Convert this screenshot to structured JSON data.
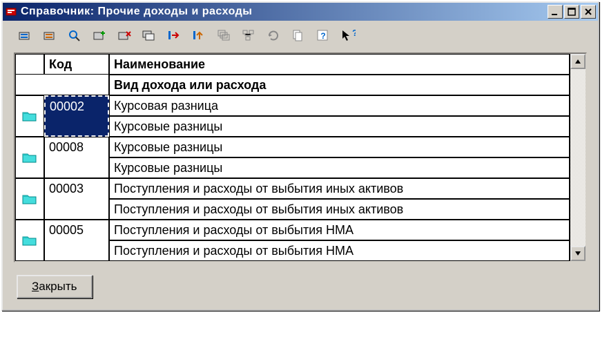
{
  "window": {
    "title": "Справочник: Прочие доходы и расходы"
  },
  "headers": {
    "code": "Код",
    "name": "Наименование",
    "subname": "Вид дохода или расхода"
  },
  "rows": [
    {
      "code": "00002",
      "name": "Курсовая разница",
      "sub": "Курсовые разницы",
      "selected": true
    },
    {
      "code": "00008",
      "name": "Курсовые разницы",
      "sub": "Курсовые разницы",
      "selected": false
    },
    {
      "code": "00003",
      "name": "Поступления и расходы от выбытия иных активов",
      "sub": "Поступления и расходы от выбытия иных активов",
      "selected": false
    },
    {
      "code": "00005",
      "name": "Поступления и расходы от выбытия НМА",
      "sub": "Поступления и расходы от выбытия НМА",
      "selected": false
    }
  ],
  "footer": {
    "close_label_prefix": "З",
    "close_label_rest": "акрыть"
  }
}
